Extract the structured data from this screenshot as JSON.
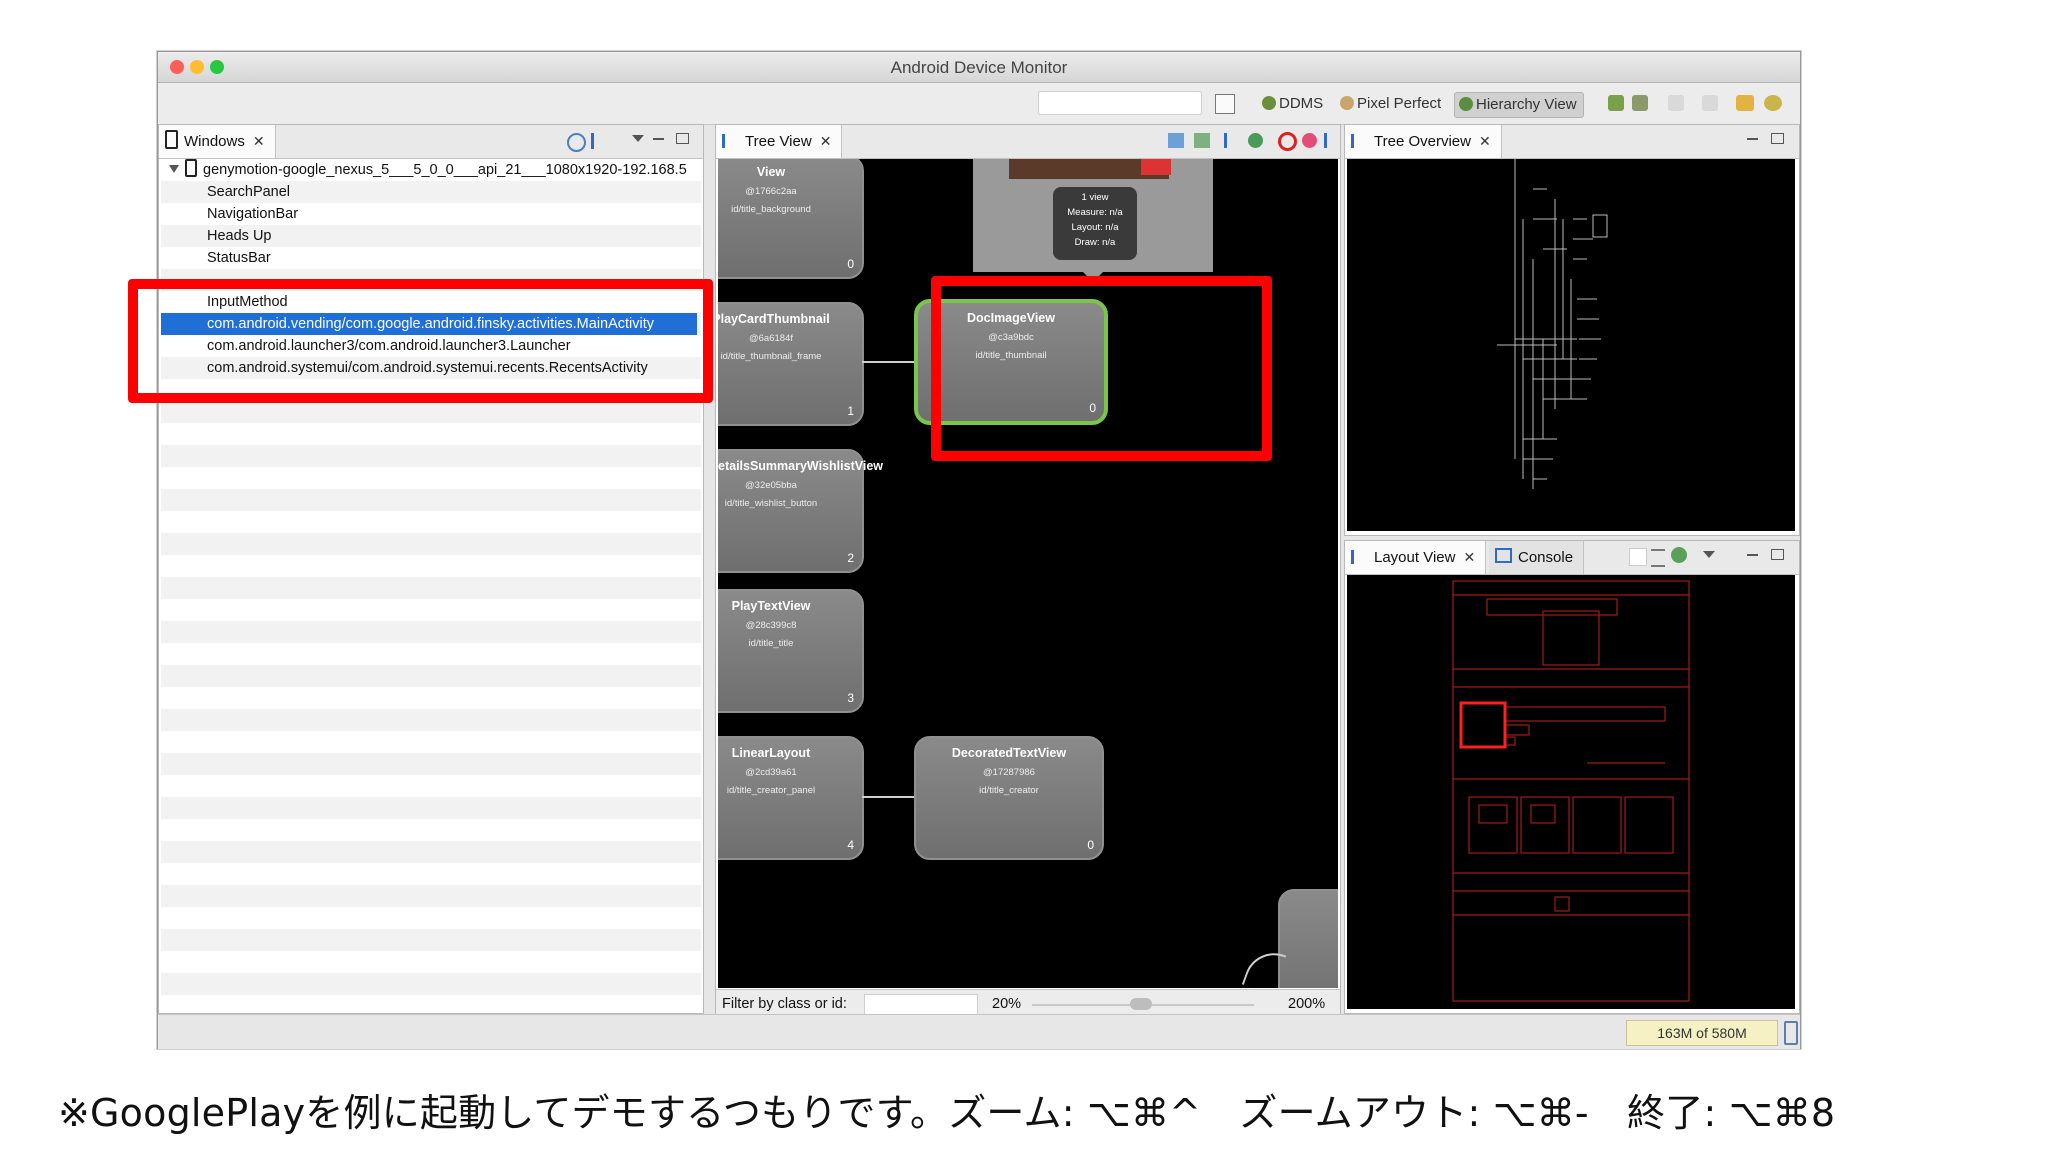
{
  "window": {
    "title": "Android Device Monitor",
    "colors": {
      "close": "#ff5f57",
      "minimize": "#febc2e",
      "zoom": "#28c840",
      "selection": "#1f6fd6",
      "highlight": "#ff0000",
      "selected_node_border": "#79c74a"
    }
  },
  "toolbar": {
    "perspectives": [
      {
        "label": "DDMS",
        "icon": "android-ddms-icon"
      },
      {
        "label": "Pixel Perfect",
        "icon": "magnifier-icon"
      },
      {
        "label": "Hierarchy View",
        "icon": "hierarchy-icon",
        "active": true
      }
    ]
  },
  "windows_panel": {
    "tab_label": "Windows",
    "device": "genymotion-google_nexus_5___5_0_0___api_21___1080x1920-192.168.5",
    "items": [
      "SearchPanel",
      "NavigationBar",
      "Heads Up",
      "StatusBar",
      "",
      "InputMethod",
      "com.android.vending/com.google.android.finsky.activities.MainActivity",
      "com.android.launcher3/com.android.launcher3.Launcher",
      "com.android.systemui/com.android.systemui.recents.RecentsActivity"
    ],
    "selected_index": 6
  },
  "tree_view": {
    "tab_label": "Tree View",
    "popup": {
      "line1": "1 view",
      "line2": "Measure: n/a",
      "line3": "Layout: n/a",
      "line4": "Draw: n/a"
    },
    "nodes": [
      {
        "name": "View",
        "hash": "@1766c2aa",
        "id": "id/title_background",
        "index": "0"
      },
      {
        "name": "PlayCardThumbnail",
        "hash": "@6a6184f",
        "id": "id/title_thumbnail_frame",
        "index": "1"
      },
      {
        "name": "etailsSummaryWishlistView",
        "hash": "@32e05bba",
        "id": "id/title_wishlist_button",
        "index": "2"
      },
      {
        "name": "PlayTextView",
        "hash": "@28c399c8",
        "id": "id/title_title",
        "index": "3"
      },
      {
        "name": "LinearLayout",
        "hash": "@2cd39a61",
        "id": "id/title_creator_panel",
        "index": "4"
      },
      {
        "name": "DocImageView",
        "hash": "@c3a9bdc",
        "id": "id/title_thumbnail",
        "index": "0"
      },
      {
        "name": "DecoratedTextView",
        "hash": "@17287986",
        "id": "id/title_creator",
        "index": "0"
      }
    ],
    "filter_label": "Filter by class or id:",
    "zoom_min": "20%",
    "zoom_max": "200%"
  },
  "tree_overview": {
    "tab_label": "Tree Overview"
  },
  "layout_view": {
    "tab_label": "Layout View",
    "console_label": "Console"
  },
  "status": {
    "memory": "163M of 580M"
  },
  "caption": "※GooglePlayを例に起動してデモするつもりです。ズーム: ⌥⌘^　ズームアウト: ⌥⌘-　終了: ⌥⌘8"
}
